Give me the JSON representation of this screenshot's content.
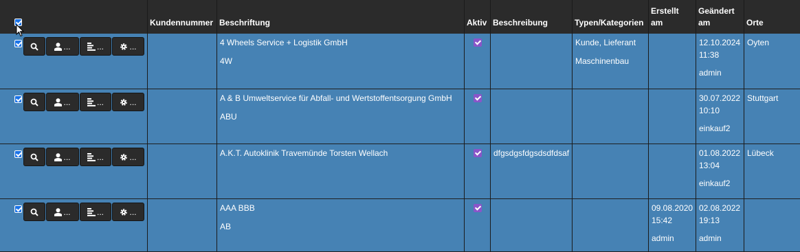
{
  "header": {
    "kundennummer": "Kundennummer",
    "beschriftung": "Beschriftung",
    "aktiv": "Aktiv",
    "beschreibung": "Beschreibung",
    "typen": "Typen/Kategorien",
    "erstellt_1": "Erstellt",
    "erstellt_2": "am",
    "geaendert_1": "Geändert",
    "geaendert_2": "am",
    "orte": "Orte"
  },
  "buttons": {
    "ellipsis": "..."
  },
  "rows": [
    {
      "name": "4 Wheels Service + Logistik GmbH",
      "short": "4W",
      "aktiv": true,
      "beschreibung": "",
      "typen": "Kunde, Lieferant",
      "kategorie": "Maschinenbau",
      "erstellt_date": "",
      "erstellt_time": "",
      "erstellt_user": "",
      "geaendert_date": "12.10.2024",
      "geaendert_time": "11:38",
      "geaendert_user": "admin",
      "ort": "Oyten"
    },
    {
      "name": "A & B Umweltservice für Abfall- und Wertstoffentsorgung GmbH",
      "short": "ABU",
      "aktiv": true,
      "beschreibung": "",
      "typen": "",
      "kategorie": "",
      "erstellt_date": "",
      "erstellt_time": "",
      "erstellt_user": "",
      "geaendert_date": "30.07.2022",
      "geaendert_time": "10:10",
      "geaendert_user": "einkauf2",
      "ort": "Stuttgart"
    },
    {
      "name": "A.K.T. Autoklinik Travemünde Torsten Wellach",
      "short": "",
      "aktiv": true,
      "beschreibung": "dfgsdgsfdgsdsdfdsaf",
      "typen": "",
      "kategorie": "",
      "erstellt_date": "",
      "erstellt_time": "",
      "erstellt_user": "",
      "geaendert_date": "01.08.2022",
      "geaendert_time": "13:04",
      "geaendert_user": "einkauf2",
      "ort": "Lübeck"
    },
    {
      "name": "AAA BBB",
      "short": "AB",
      "aktiv": true,
      "beschreibung": "",
      "typen": "",
      "kategorie": "",
      "erstellt_date": "09.08.2020",
      "erstellt_time": "15:42",
      "erstellt_user": "admin",
      "geaendert_date": "02.08.2022",
      "geaendert_time": "19:13",
      "geaendert_user": "admin",
      "ort": ""
    }
  ],
  "colors": {
    "row_bg": "#4682b4",
    "header_bg": "#2b2b2b",
    "checkbox": "#1a73e8",
    "aktiv_check": "#8a55c9"
  },
  "icons": [
    "search-icon",
    "user-icon",
    "list-icon",
    "gear-icon"
  ]
}
